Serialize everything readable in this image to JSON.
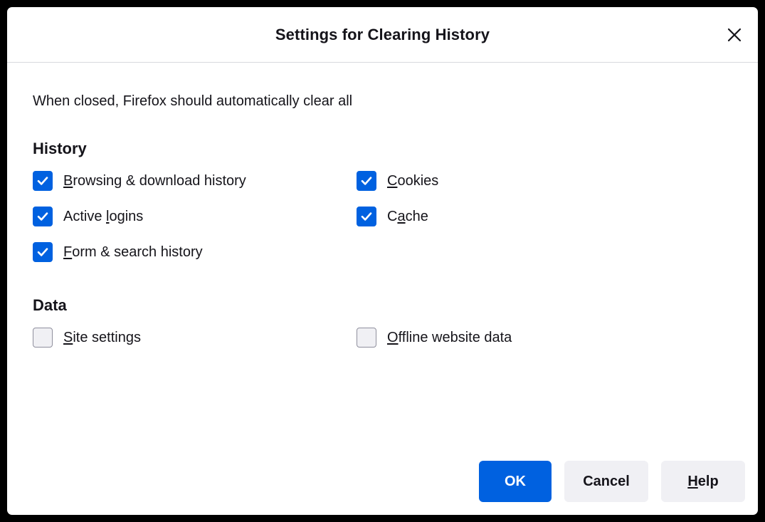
{
  "window": {
    "title": "Settings for Clearing History",
    "close_icon": "close-icon",
    "frame_color": "#000000",
    "background": "#ffffff"
  },
  "colors": {
    "accent": "#0061e0",
    "checkbox_checked_bg": "#0061e0",
    "checkbox_unchecked_bg": "#f0f0f4",
    "checkbox_unchecked_border": "#8f8f9d",
    "text": "#15141a",
    "separator": "#d7d9dd",
    "button_secondary_bg": "#f0f0f4"
  },
  "body": {
    "intro_text": "When closed, Firefox should automatically clear all"
  },
  "sections": [
    {
      "heading": "History",
      "items": [
        {
          "label_pre": "",
          "accesskey": "B",
          "label_post": "rowsing & download history",
          "checked": true,
          "name": "checkbox-browsing-download-history"
        },
        {
          "label_pre": "",
          "accesskey": "C",
          "label_post": "ookies",
          "checked": true,
          "name": "checkbox-cookies"
        },
        {
          "label_pre": "Active ",
          "accesskey": "l",
          "label_post": "ogins",
          "checked": true,
          "name": "checkbox-active-logins"
        },
        {
          "label_pre": "C",
          "accesskey": "a",
          "label_post": "che",
          "checked": true,
          "name": "checkbox-cache"
        },
        {
          "label_pre": "",
          "accesskey": "F",
          "label_post": "orm & search history",
          "checked": true,
          "name": "checkbox-form-search-history"
        },
        {
          "label_pre": "",
          "accesskey": "",
          "label_post": "",
          "checked": false,
          "name": "checkbox-empty-slot",
          "empty": true
        }
      ]
    },
    {
      "heading": "Data",
      "items": [
        {
          "label_pre": "",
          "accesskey": "S",
          "label_post": "ite settings",
          "checked": false,
          "name": "checkbox-site-settings"
        },
        {
          "label_pre": "",
          "accesskey": "O",
          "label_post": "ffline website data",
          "checked": false,
          "name": "checkbox-offline-website-data"
        }
      ]
    }
  ],
  "footer": {
    "buttons": [
      {
        "label_pre": "OK",
        "accesskey": "",
        "label_post": "",
        "style": "primary",
        "name": "ok-button"
      },
      {
        "label_pre": "Cancel",
        "accesskey": "",
        "label_post": "",
        "style": "secondary",
        "name": "cancel-button"
      },
      {
        "label_pre": "",
        "accesskey": "H",
        "label_post": "elp",
        "style": "secondary",
        "name": "help-button"
      }
    ]
  }
}
